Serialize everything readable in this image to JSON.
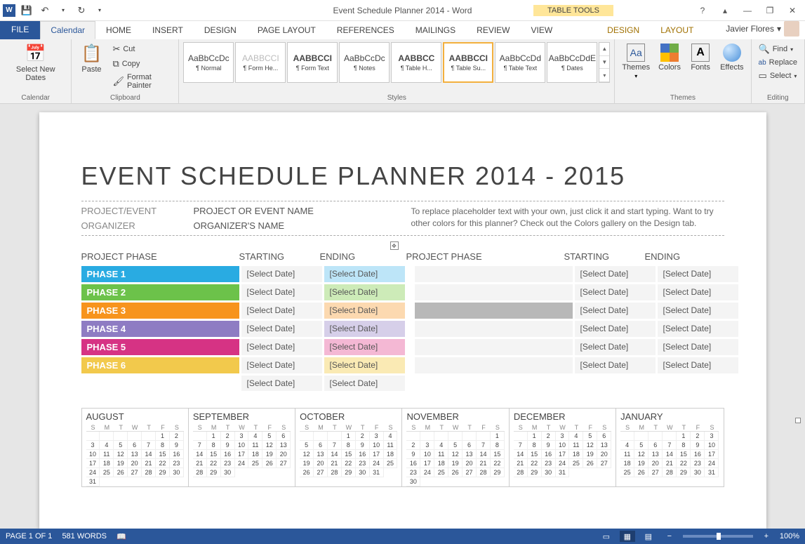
{
  "titlebar": {
    "app_icon_text": "W",
    "doc_title": "Event Schedule Planner 2014 - Word",
    "table_tools": "TABLE TOOLS",
    "help": "?",
    "ribbon_toggle": "▴",
    "minimize": "—",
    "restore": "❐",
    "close": "✕"
  },
  "qat": {
    "save": "💾",
    "undo": "↶",
    "redo": "↻",
    "more": "▾"
  },
  "tabs": {
    "file": "FILE",
    "calendar": "Calendar",
    "home": "HOME",
    "insert": "INSERT",
    "design": "DESIGN",
    "pagelayout": "PAGE LAYOUT",
    "references": "REFERENCES",
    "mailings": "MAILINGS",
    "review": "REVIEW",
    "view": "VIEW",
    "ctx_design": "DESIGN",
    "ctx_layout": "LAYOUT"
  },
  "user": {
    "name": "Javier Flores",
    "caret": "▾"
  },
  "ribbon": {
    "calendar": {
      "select_dates": "Select New Dates",
      "group": "Calendar",
      "icon": "📅"
    },
    "clipboard": {
      "paste": "Paste",
      "paste_icon": "📋",
      "cut": "Cut",
      "cut_icon": "✂",
      "copy": "Copy",
      "copy_icon": "⧉",
      "format_painter": "Format Painter",
      "fp_icon": "🖌",
      "group": "Clipboard"
    },
    "styles": {
      "group": "Styles",
      "items": [
        {
          "preview": "AaBbCcDc",
          "name": "¶ Normal"
        },
        {
          "preview": "AABBCCI",
          "name": "¶ Form He..."
        },
        {
          "preview": "AABBCCI",
          "name": "¶ Form Text"
        },
        {
          "preview": "AaBbCcDc",
          "name": "¶ Notes"
        },
        {
          "preview": "AABBCC",
          "name": "¶ Table H..."
        },
        {
          "preview": "AABBCCI",
          "name": "¶ Table Su..."
        },
        {
          "preview": "AaBbCcDd",
          "name": "¶ Table Text"
        },
        {
          "preview": "AaBbCcDdE",
          "name": "¶ Dates"
        }
      ]
    },
    "themes": {
      "themes": "Themes",
      "colors": "Colors",
      "fonts": "Fonts",
      "effects": "Effects",
      "group": "Themes"
    },
    "editing": {
      "find": "Find",
      "find_icon": "🔍",
      "replace": "Replace",
      "replace_icon": "ab",
      "select": "Select",
      "select_icon": "▭",
      "group": "Editing",
      "caret": "▾"
    }
  },
  "document": {
    "title": "EVENT SCHEDULE PLANNER 2014 - 2015",
    "project_label": "PROJECT/EVENT",
    "project_value": "PROJECT OR EVENT NAME",
    "organizer_label": "ORGANIZER",
    "organizer_value": "ORGANIZER'S NAME",
    "help_text": "To replace placeholder text with your own, just click it and start typing. Want to try other colors for this planner? Check out the Colors gallery on the Design tab.",
    "headers": {
      "phase": "PROJECT PHASE",
      "starting": "STARTING",
      "ending": "ENDING"
    },
    "select_date": "[Select Date]",
    "table_handle": "✥",
    "phases": [
      {
        "name": "PHASE 1",
        "color": "#29abe2",
        "light": "#bde5f8"
      },
      {
        "name": "PHASE 2",
        "color": "#6cc24a",
        "light": "#cdebb8"
      },
      {
        "name": "PHASE 3",
        "color": "#f7941d",
        "light": "#fcd9b0"
      },
      {
        "name": "PHASE 4",
        "color": "#8e7cc3",
        "light": "#d6cfe9"
      },
      {
        "name": "PHASE 5",
        "color": "#d63384",
        "light": "#f4b8d4"
      },
      {
        "name": "PHASE 6",
        "color": "#f2c94c",
        "light": "#faeab4"
      }
    ],
    "empty_extra": {
      "default": "#f4f4f4",
      "grey": "#b8b8b8"
    },
    "calendar": {
      "dow": [
        "S",
        "M",
        "T",
        "W",
        "T",
        "F",
        "S"
      ],
      "months": [
        {
          "name": "AUGUST",
          "start": 5,
          "days": 31
        },
        {
          "name": "SEPTEMBER",
          "start": 1,
          "days": 30
        },
        {
          "name": "OCTOBER",
          "start": 3,
          "days": 31
        },
        {
          "name": "NOVEMBER",
          "start": 6,
          "days": 30
        },
        {
          "name": "DECEMBER",
          "start": 1,
          "days": 31
        },
        {
          "name": "JANUARY",
          "start": 4,
          "days": 31
        }
      ]
    }
  },
  "statusbar": {
    "page": "PAGE 1 OF 1",
    "words": "581 WORDS",
    "proof_icon": "📖",
    "zoom_minus": "−",
    "zoom_plus": "+",
    "zoom": "100%"
  }
}
